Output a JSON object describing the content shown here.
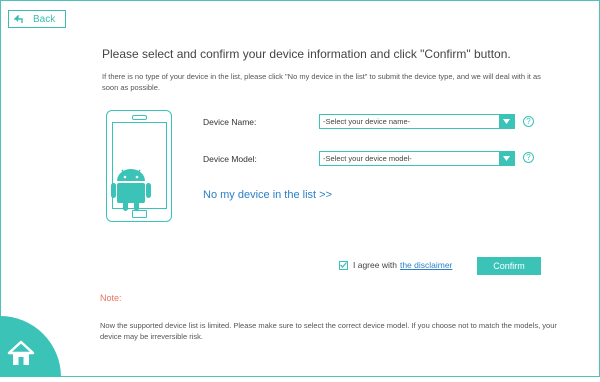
{
  "header": {
    "back_label": "Back"
  },
  "main": {
    "title": "Please select and confirm your device information and click \"Confirm\" button.",
    "subtext": "If there is no type of your device in the list, please click \"No my device in the list\" to submit the device type, and we will deal with it as soon as possible.",
    "device_name_label": "Device Name:",
    "device_name_value": "-Select your device name-",
    "device_model_label": "Device Model:",
    "device_model_value": "-Select your device model-",
    "help_glyph": "?",
    "no_device_link": "No my device in the list >>"
  },
  "footer": {
    "agree_text": "I agree with",
    "disclaimer_link": "the disclaimer",
    "agree_checked": true,
    "confirm_label": "Confirm",
    "note_label": "Note:",
    "note_text": "Now the supported device list is limited. Please make sure to select the correct device model. If you choose not to match the models, your device may be irreversible risk."
  },
  "colors": {
    "accent": "#3cc3b8",
    "link": "#2b7fc7",
    "note": "#e8745e",
    "android_green": "#3cc3b8"
  },
  "icons": {
    "back": "back-arrow-icon",
    "dropdown": "chevron-down-icon",
    "help": "question-icon",
    "checkbox": "checkmark-icon",
    "home": "home-icon",
    "device": "android-phone-icon"
  }
}
